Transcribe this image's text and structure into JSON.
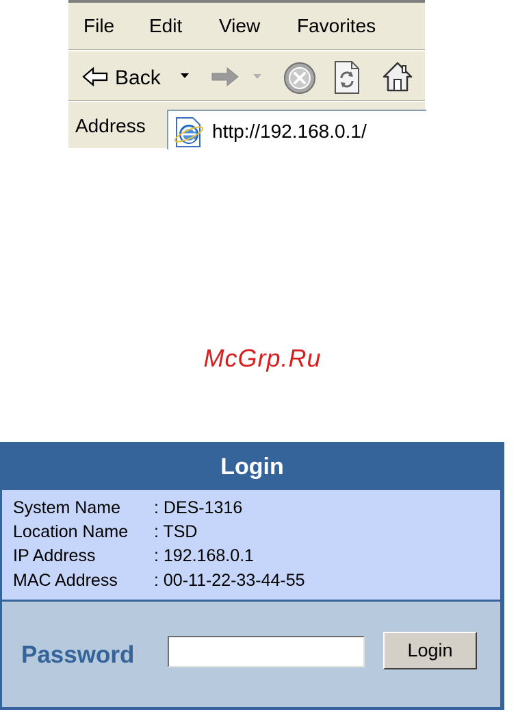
{
  "browser": {
    "menu": [
      "File",
      "Edit",
      "View",
      "Favorites"
    ],
    "toolbar": {
      "back_label": "Back",
      "icons": [
        "back-arrow-icon",
        "dropdown-arrow-icon",
        "forward-arrow-icon",
        "dropdown-arrow-icon",
        "stop-icon",
        "refresh-icon",
        "home-icon"
      ]
    },
    "address": {
      "label": "Address",
      "value": "http://192.168.0.1/",
      "icon": "ie-page-icon"
    }
  },
  "watermark": "McGrp.Ru",
  "login": {
    "title": "Login",
    "info": [
      {
        "label": "System Name",
        "value": ": DES-1316"
      },
      {
        "label": "Location Name",
        "value": ": TSD"
      },
      {
        "label": "IP Address",
        "value": ": 192.168.0.1"
      },
      {
        "label": "MAC Address",
        "value": ": 00-11-22-33-44-55"
      }
    ],
    "password_label": "Password",
    "password_value": "",
    "button_label": "Login"
  },
  "colors": {
    "panel_blue": "#34649a",
    "info_bg": "#c6d6fb",
    "password_bg": "#b6c9dd",
    "watermark": "#d62020"
  }
}
